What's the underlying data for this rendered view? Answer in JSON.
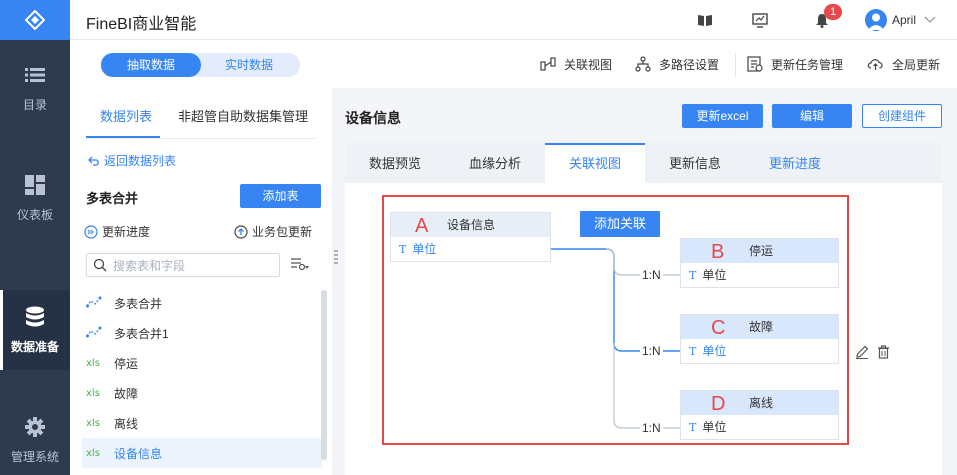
{
  "app": {
    "title": "FineBI商业智能"
  },
  "header": {
    "notification_count": "1",
    "user_name": "April"
  },
  "nav": {
    "items": [
      {
        "label": "目录"
      },
      {
        "label": "仪表板"
      },
      {
        "label": "数据准备"
      },
      {
        "label": "管理系统"
      }
    ]
  },
  "subbar": {
    "mode_switch": {
      "extract": "抽取数据",
      "realtime": "实时数据"
    },
    "tools": [
      {
        "label": "关联视图"
      },
      {
        "label": "多路径设置"
      },
      {
        "label": "更新任务管理"
      },
      {
        "label": "全局更新"
      }
    ]
  },
  "left_panel": {
    "tabs": [
      {
        "label": "数据列表"
      },
      {
        "label": "非超管自助数据集管理"
      }
    ],
    "back_link": "返回数据列表",
    "group_title": "多表合并",
    "add_table": "添加表",
    "update_progress": "更新进度",
    "package_update": "业务包更新",
    "search_placeholder": "搜索表和字段",
    "items": [
      {
        "icon": "self-dataset-icon",
        "label": "多表合并"
      },
      {
        "icon": "self-dataset-icon",
        "label": "多表合并1"
      },
      {
        "icon": "xls",
        "label": "停运"
      },
      {
        "icon": "xls",
        "label": "故障"
      },
      {
        "icon": "xls",
        "label": "离线"
      },
      {
        "icon": "xls",
        "label": "设备信息"
      }
    ]
  },
  "main": {
    "title": "设备信息",
    "buttons": {
      "update_excel": "更新excel",
      "edit": "编辑",
      "create_component": "创建组件"
    },
    "tabs": [
      {
        "label": "数据预览"
      },
      {
        "label": "血缘分析"
      },
      {
        "label": "关联视图"
      },
      {
        "label": "更新信息"
      },
      {
        "label": "更新进度"
      }
    ],
    "diagram": {
      "add_relation": "添加关联",
      "nodes": [
        {
          "letter": "A",
          "name": "设备信息",
          "field": "单位"
        },
        {
          "letter": "B",
          "name": "停运",
          "field": "单位"
        },
        {
          "letter": "C",
          "name": "故障",
          "field": "单位"
        },
        {
          "letter": "D",
          "name": "离线",
          "field": "单位"
        }
      ],
      "relations": [
        "1:N",
        "1:N",
        "1:N"
      ]
    }
  },
  "colors": {
    "accent": "#3685f2",
    "nav_bg": "#2e3b4e",
    "highlight_red": "#e5484d"
  }
}
